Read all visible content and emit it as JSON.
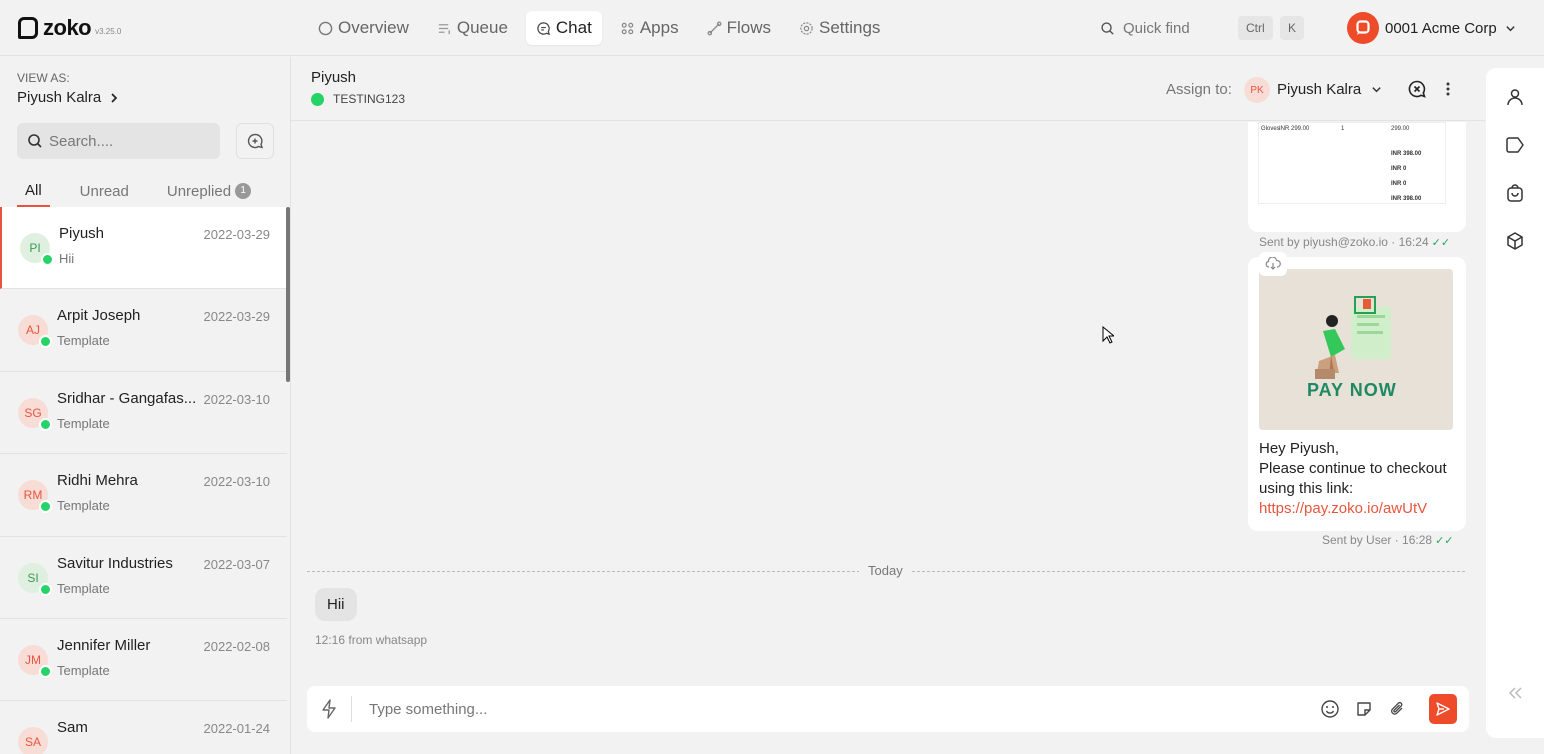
{
  "app": {
    "name": "zoko",
    "version": "v3.25.0"
  },
  "nav": {
    "items": [
      {
        "label": "Overview",
        "icon": "circle-icon"
      },
      {
        "label": "Queue",
        "icon": "queue-icon"
      },
      {
        "label": "Chat",
        "icon": "chat-icon"
      },
      {
        "label": "Apps",
        "icon": "apps-icon"
      },
      {
        "label": "Flows",
        "icon": "flows-icon"
      },
      {
        "label": "Settings",
        "icon": "gear-icon"
      }
    ],
    "active": "Chat"
  },
  "quickfind": {
    "label": "Quick find",
    "key1": "Ctrl",
    "key2": "K"
  },
  "org": {
    "name": "0001 Acme Corp"
  },
  "sidebar": {
    "view_as_label": "VIEW AS:",
    "view_as_name": "Piyush Kalra",
    "search_placeholder": "Search....",
    "tabs": [
      {
        "label": "All"
      },
      {
        "label": "Unread"
      },
      {
        "label": "Unreplied",
        "badge": "1"
      }
    ],
    "chats": [
      {
        "initials": "PI",
        "name": "Piyush",
        "date": "2022-03-29",
        "preview": "Hii",
        "avatar_bg": "#dff0e0",
        "avatar_fg": "#3a9a55"
      },
      {
        "initials": "AJ",
        "name": "Arpit Joseph",
        "date": "2022-03-29",
        "preview": "Template",
        "avatar_bg": "#f8dcd6",
        "avatar_fg": "#e8553e"
      },
      {
        "initials": "SG",
        "name": "Sridhar - Gangafas...",
        "date": "2022-03-10",
        "preview": "Template",
        "avatar_bg": "#f8dcd6",
        "avatar_fg": "#e8553e"
      },
      {
        "initials": "RM",
        "name": "Ridhi Mehra",
        "date": "2022-03-10",
        "preview": "Template",
        "avatar_bg": "#f8dcd6",
        "avatar_fg": "#e8553e"
      },
      {
        "initials": "SI",
        "name": "Savitur Industries",
        "date": "2022-03-07",
        "preview": "Template",
        "avatar_bg": "#dff0e0",
        "avatar_fg": "#3a9a55"
      },
      {
        "initials": "JM",
        "name": "Jennifer Miller",
        "date": "2022-02-08",
        "preview": "Template",
        "avatar_bg": "#f8dcd6",
        "avatar_fg": "#e8553e"
      },
      {
        "initials": "SA",
        "name": "Sam",
        "date": "2022-01-24",
        "preview": "",
        "avatar_bg": "#f8dcd6",
        "avatar_fg": "#e8553e"
      }
    ]
  },
  "chat": {
    "name": "Piyush",
    "channel": "TESTING123",
    "assign_label": "Assign to:",
    "assignee_initials": "PK",
    "assignee_name": "Piyush Kalra"
  },
  "messages": {
    "invoice": {
      "row_item": "Gloves",
      "row_price": "INR 299.00",
      "row_qty": "1",
      "row_total": "299.00",
      "subtotal": "INR 398.00",
      "tax": "INR 0",
      "shipping": "INR 0",
      "total": "INR 398.00",
      "meta": "Sent by piyush@zoko.io · 16:24"
    },
    "pay": {
      "image_text": "PAY NOW",
      "line1": "Hey Piyush,",
      "line2": "Please continue to checkout using this link:",
      "link": "https://pay.zoko.io/awUtV",
      "meta": "Sent by User · 16:28"
    },
    "divider": "Today",
    "incoming": {
      "text": "Hii",
      "meta": "12:16 from whatsapp"
    }
  },
  "composer": {
    "placeholder": "Type something..."
  },
  "colors": {
    "accent": "#ee4b2b",
    "whatsapp": "#25d366"
  }
}
